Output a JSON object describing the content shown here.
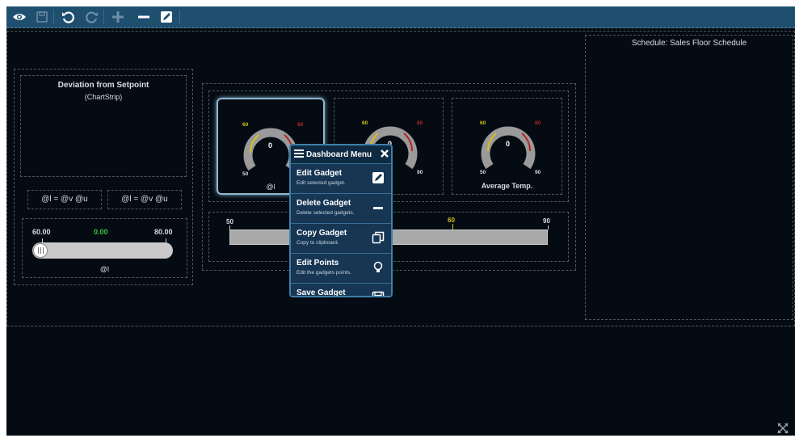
{
  "toolbar": {
    "icons": [
      "eye-icon",
      "save-icon",
      "undo-icon",
      "redo-icon",
      "plus-icon",
      "minus-icon",
      "edit-icon"
    ]
  },
  "chartstrip": {
    "title": "Deviation from Setpoint",
    "subtitle": "(ChartStrip)"
  },
  "labels": {
    "left": "@l = @v @u",
    "right": "@l = @v @u"
  },
  "slider": {
    "min": "60.00",
    "value": "0.00",
    "max": "80.00",
    "label": "@l",
    "level": 0
  },
  "gauges": [
    {
      "label": "@l",
      "low": "60",
      "high": "80",
      "value": "0",
      "min": "50",
      "max": "90"
    },
    {
      "label": "",
      "low": "60",
      "high": "80",
      "value": "0",
      "min": "50",
      "max": "90"
    },
    {
      "label": "Average Temp.",
      "low": "60",
      "high": "80",
      "value": "0",
      "min": "50",
      "max": "90"
    }
  ],
  "bar": {
    "min": "50",
    "mid": "60",
    "max": "90"
  },
  "schedule": {
    "title": "Schedule: Sales Floor Schedule"
  },
  "menu": {
    "title": "Dashboard Menu",
    "items": [
      {
        "label": "Edit Gadget",
        "desc": "Edit selected gadget.",
        "icon": "pencil-icon"
      },
      {
        "label": "Delete Gadget",
        "desc": "Delete selected gadgets.",
        "icon": "minus-icon"
      },
      {
        "label": "Copy Gadget",
        "desc": "Copy to clipboard.",
        "icon": "copy-icon"
      },
      {
        "label": "Edit Points",
        "desc": "Edit the gadgets points.",
        "icon": "bulb-icon"
      },
      {
        "label": "Save Gadget",
        "desc": "",
        "icon": "save-icon"
      }
    ]
  },
  "colors": {
    "toolbar": "#1e4f6f",
    "background": "#050b13",
    "menu": "#163654",
    "accent_green": "#36c43a",
    "accent_yellow": "#d4c21a",
    "accent_red": "#b32323"
  }
}
